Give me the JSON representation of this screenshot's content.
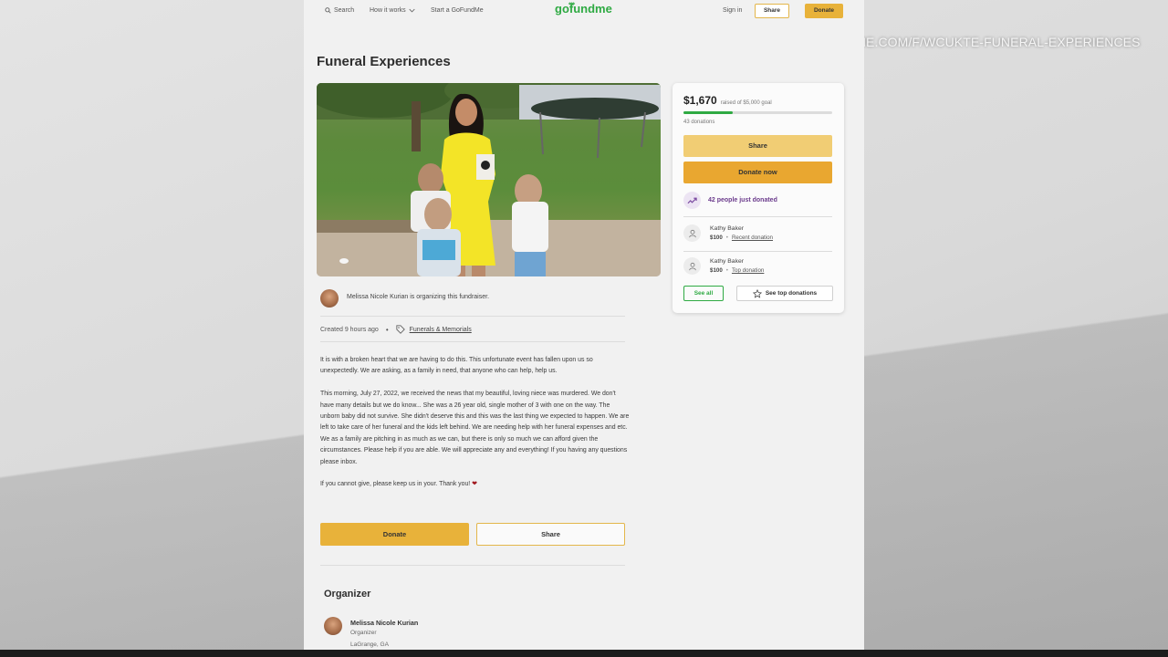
{
  "overlay": {
    "url": "GOFUNDME.COM/F/WCUKTE-FUNERAL-EXPERIENCES"
  },
  "nav": {
    "search": "Search",
    "how_it_works": "How it works",
    "start": "Start a GoFundMe",
    "logo": "gofundme",
    "sign_in": "Sign in",
    "share": "Share",
    "donate": "Donate"
  },
  "campaign": {
    "title": "Funeral Experiences",
    "organizer_line": "Melissa Nicole Kurian is organizing this fundraiser.",
    "created": "Created 9 hours ago",
    "category": "Funerals & Memorials",
    "story": [
      "It is with a broken heart that we are having to do this. This unfortunate event has fallen upon us so unexpectedly. We are asking, as a family in need, that anyone who can help, help us.",
      "This morning, July 27, 2022, we received the news that my beautiful, loving niece was murdered. We don't have many details but we do know... She was a 26 year old, single mother of 3 with one on the way. The unborn baby did not survive. She didn't deserve this and this was the last thing we expected to happen. We are left to take care of her funeral and the kids left behind. We are needing help with her funeral expenses and etc. We as a family are pitching in as much as we can, but there is only so much we can afford given the circumstances. Please help if you are able. We will appreciate any and everything! If you having any questions please inbox.",
      "If you cannot give, please keep us in your. Thank you!"
    ],
    "donate_button": "Donate",
    "share_button": "Share"
  },
  "organizer": {
    "heading": "Organizer",
    "name": "Melissa Nicole Kurian",
    "role": "Organizer",
    "location": "LaGrange, GA"
  },
  "sidebar": {
    "raised": "$1,670",
    "goal_text": "raised of $5,000 goal",
    "progress_fraction": 0.334,
    "donations": "43 donations",
    "share": "Share",
    "donate_now": "Donate now",
    "just_donated": "42 people just donated",
    "donors": [
      {
        "name": "Kathy Baker",
        "amount": "$100",
        "label": "Recent donation"
      },
      {
        "name": "Kathy Baker",
        "amount": "$100",
        "label": "Top donation"
      }
    ],
    "see_all": "See all",
    "see_top": "See top donations"
  },
  "colors": {
    "brand_green": "#2faa43",
    "donate_yellow": "#e8b23a",
    "trend_purple": "#6b3b8c"
  }
}
